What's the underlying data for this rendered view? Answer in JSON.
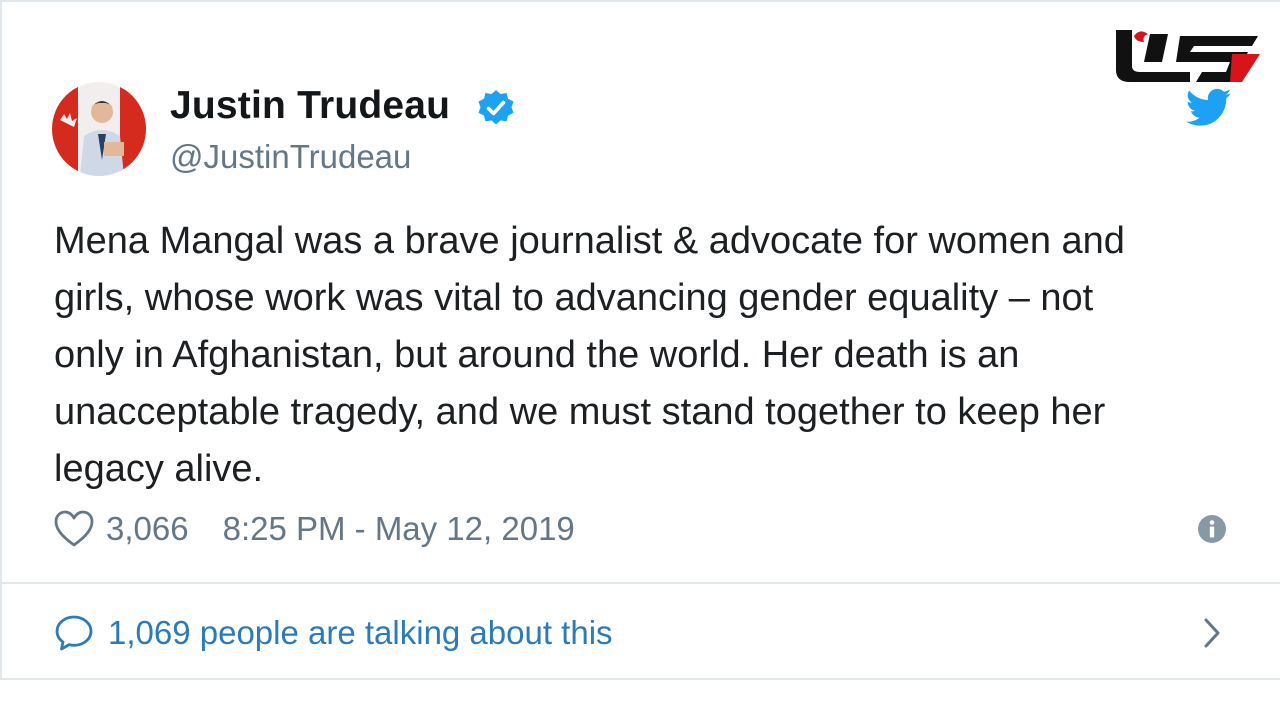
{
  "author": {
    "name": "Justin Trudeau",
    "handle": "@JustinTrudeau",
    "verified": true
  },
  "tweet": {
    "lines": [
      "Mena Mangal was a brave journalist & advocate for women and",
      "girls, whose work was vital to advancing gender equality – not",
      "only in Afghanistan, but around the world. Her death is an",
      "unacceptable tragedy, and we must stand together to keep her",
      "legacy alive."
    ],
    "likes": "3,066",
    "timestamp": "8:25 PM - May 12, 2019"
  },
  "footer": {
    "talking_label": "1,069 people are talking about this"
  },
  "icons": {
    "verified": "verified-badge-icon",
    "twitter": "twitter-bird-icon",
    "like": "heart-icon",
    "info": "info-icon",
    "reply": "speech-bubble-icon",
    "chevron": "chevron-right-icon",
    "watermark": "site-logo"
  },
  "colors": {
    "verified_blue": "#1da1f2",
    "link_blue": "#2b7bb9",
    "text": "#1c2022",
    "muted": "#657786",
    "watermark_red": "#d7141a"
  }
}
